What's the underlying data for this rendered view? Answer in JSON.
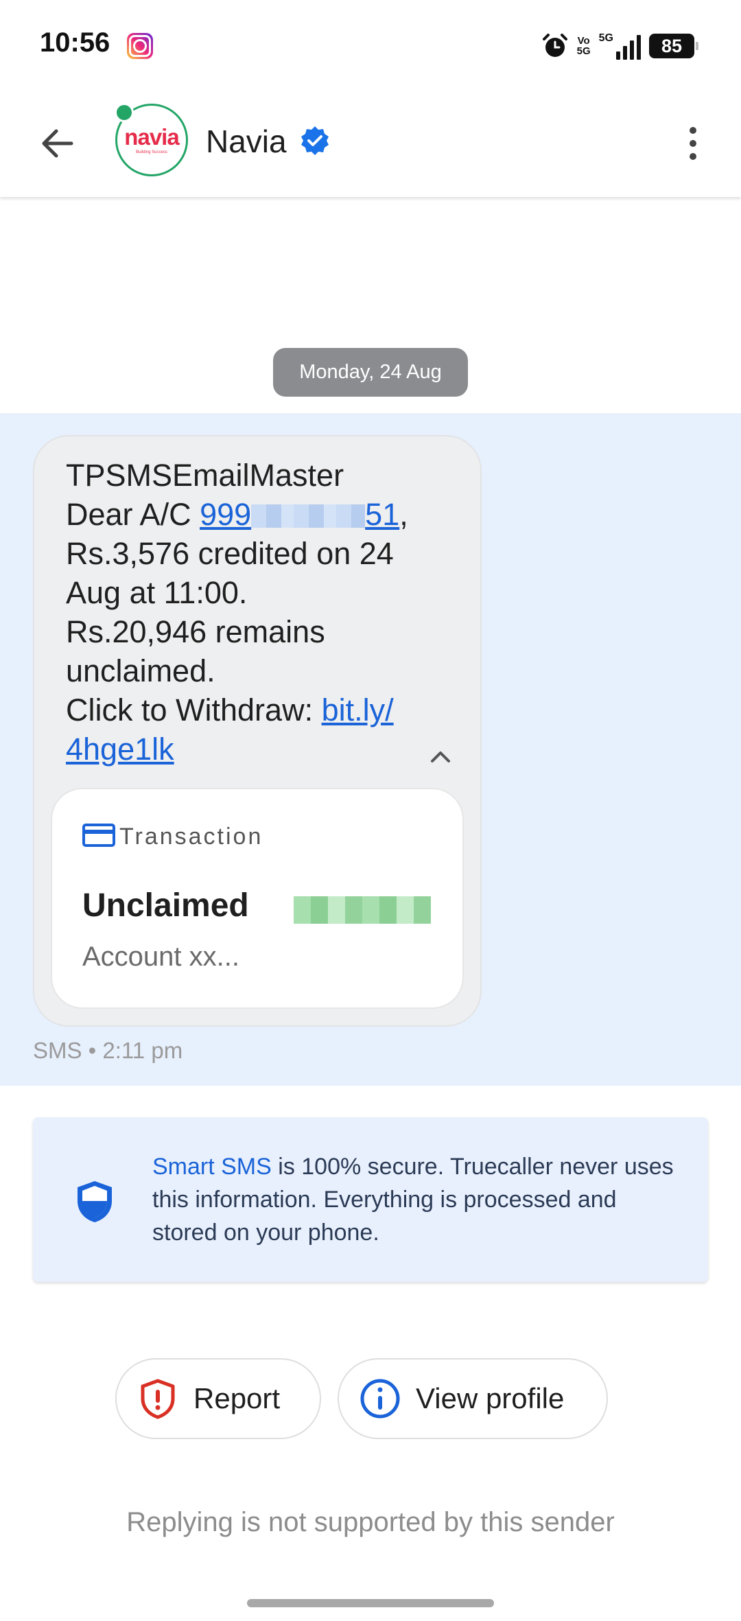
{
  "status_bar": {
    "time": "10:56",
    "volte_top": "Vo",
    "volte_bottom": "5G",
    "network": "5G",
    "battery": "85"
  },
  "header": {
    "contact_name": "Navia",
    "avatar_text_a": "n",
    "avatar_text_b": "avia",
    "avatar_tagline": "Building Success"
  },
  "conversation": {
    "date_chip": "Monday, 24 Aug",
    "message": {
      "line1": "TPSMSEmailMaster",
      "line2_prefix": "Dear A/C ",
      "account_start": "999",
      "account_end": "51",
      "line2_suffix": ",",
      "line3": "Rs.3,576 credited on 24",
      "line4": "Aug at 11:00.",
      "line5": "Rs.20,946 remains",
      "line6": "unclaimed.",
      "line7_prefix": "Click to Withdraw: ",
      "link_part1": "bit.ly/",
      "link_part2": "4hge1lk"
    },
    "card": {
      "label": "Transaction",
      "title": "Unclaimed",
      "account": "Account xx..."
    },
    "meta": "SMS • 2:11 pm"
  },
  "info_card": {
    "highlight": "Smart SMS",
    "text": " is 100% secure. Truecaller never uses this information. Everything is processed and stored on your phone."
  },
  "actions": {
    "report_label": "Report",
    "view_profile_label": "View profile"
  },
  "footer_note": "Replying is not supported by this sender",
  "colors": {
    "accent": "#1a63d8",
    "highlight_bg": "#e7f0fd",
    "report_red": "#d93025"
  }
}
